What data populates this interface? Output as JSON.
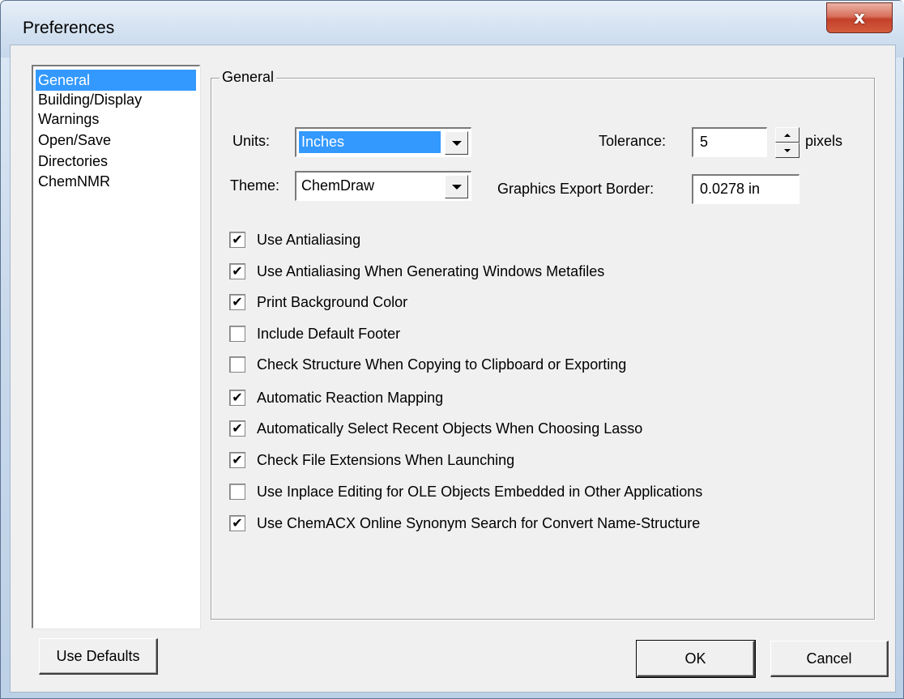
{
  "window": {
    "title": "Preferences",
    "close_glyph": "x"
  },
  "sidebar": {
    "items": [
      {
        "label": "General",
        "selected": true
      },
      {
        "label": "Building/Display",
        "selected": false
      },
      {
        "label": "Warnings",
        "selected": false
      },
      {
        "label": "Open/Save",
        "selected": false
      },
      {
        "label": "Directories",
        "selected": false
      },
      {
        "label": "ChemNMR",
        "selected": false
      }
    ]
  },
  "general": {
    "group_title": "General",
    "units_label": "Units:",
    "units_value": "Inches",
    "theme_label": "Theme:",
    "theme_value": "ChemDraw",
    "tolerance_label": "Tolerance:",
    "tolerance_value": "5",
    "tolerance_unit": "pixels",
    "export_border_label": "Graphics Export Border:",
    "export_border_value": "0.0278 in",
    "checkboxes": [
      {
        "label": "Use Antialiasing",
        "checked": true
      },
      {
        "label": "Use Antialiasing When Generating Windows Metafiles",
        "checked": true
      },
      {
        "label": "Print Background Color",
        "checked": true
      },
      {
        "label": "Include Default Footer",
        "checked": false
      },
      {
        "label": "Check Structure When Copying to Clipboard or Exporting",
        "checked": false
      },
      {
        "label": "Automatic Reaction Mapping",
        "checked": true
      },
      {
        "label": "Automatically Select Recent Objects When Choosing Lasso",
        "checked": true
      },
      {
        "label": "Check File Extensions When Launching",
        "checked": true
      },
      {
        "label": "Use Inplace Editing for OLE Objects Embedded in Other Applications",
        "checked": false
      },
      {
        "label": "Use ChemACX Online Synonym Search for Convert Name-Structure",
        "checked": true
      }
    ]
  },
  "buttons": {
    "use_defaults": "Use Defaults",
    "ok": "OK",
    "cancel": "Cancel"
  },
  "colors": {
    "selection": "#3399ff",
    "dialog_bg": "#f0f0f0"
  }
}
